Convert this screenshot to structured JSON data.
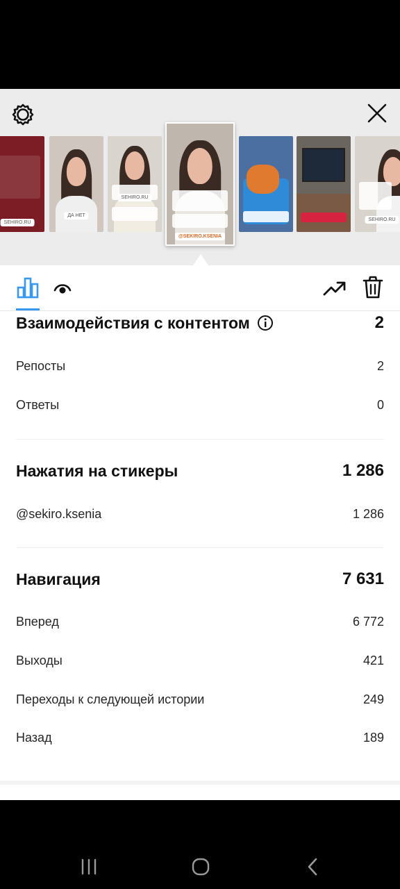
{
  "colors": {
    "accent": "#3897f0",
    "background": "#ffffff",
    "text": "#262626"
  },
  "story_header": {
    "settings_icon": "gear-icon",
    "close_icon": "close-icon"
  },
  "stories": [
    {
      "tag": "SEHIRO.RU"
    },
    {
      "tag": "ДА   НЕТ"
    },
    {
      "tag": "SEHIRO.RU"
    },
    {
      "tag": "@SEKIRO.KSENIA"
    },
    {
      "tag": ""
    },
    {
      "tag": ""
    },
    {
      "tag": "SEHIRO.RU"
    }
  ],
  "tabs": [
    {
      "icon": "bar-chart-icon",
      "selected": true
    },
    {
      "icon": "eye-icon",
      "selected": false
    },
    {
      "icon": "trending-up-icon",
      "selected": false
    },
    {
      "icon": "trash-icon",
      "selected": false
    }
  ],
  "interactions": {
    "title": "Взаимодействия с контентом",
    "info_icon": "info-icon",
    "total": "2",
    "rows": [
      {
        "label": "Репосты",
        "value": "2"
      },
      {
        "label": "Ответы",
        "value": "0"
      }
    ]
  },
  "stickers": {
    "title": "Нажатия на стикеры",
    "total": "1 286",
    "rows": [
      {
        "label": "@sekiro.ksenia",
        "value": "1 286"
      }
    ]
  },
  "navigation": {
    "title": "Навигация",
    "total": "7 631",
    "rows": [
      {
        "label": "Вперед",
        "value": "6 772"
      },
      {
        "label": "Выходы",
        "value": "421"
      },
      {
        "label": "Переходы к следующей истории",
        "value": "249"
      },
      {
        "label": "Назад",
        "value": "189"
      }
    ]
  },
  "system_nav": {
    "recents_icon": "recents-icon",
    "home_icon": "home-icon",
    "back_icon": "back-icon"
  }
}
